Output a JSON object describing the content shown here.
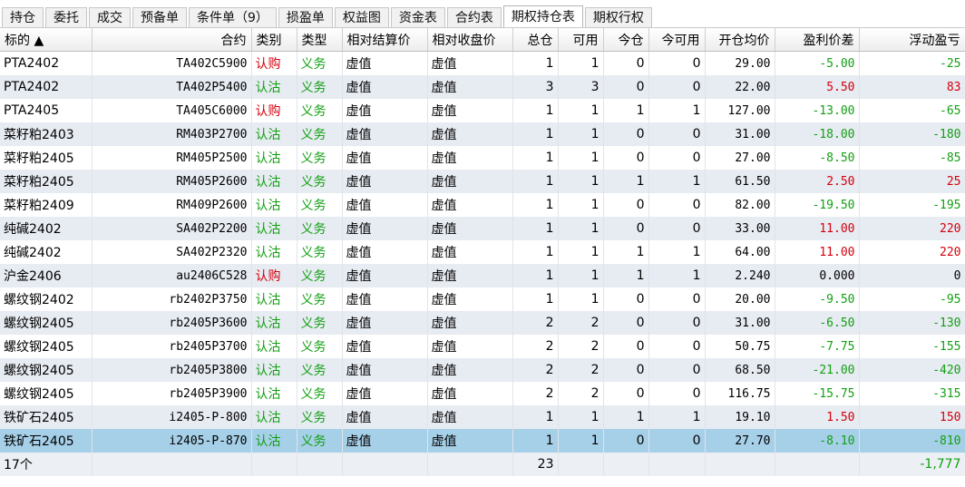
{
  "tabs": [
    "持仓",
    "委托",
    "成交",
    "预备单",
    "条件单（9）",
    "损盈单",
    "权益图",
    "资金表",
    "合约表",
    "期权持仓表",
    "期权行权"
  ],
  "active_tab": 9,
  "columns": [
    "标的 ▲",
    "合约",
    "类别",
    "类型",
    "相对结算价",
    "相对收盘价",
    "总仓",
    "可用",
    "今仓",
    "今可用",
    "开仓均价",
    "盈利价差",
    "浮动盈亏"
  ],
  "rows": [
    [
      "PTA2402",
      "TA402C5900",
      "认购",
      "义务",
      "虚值",
      "虚值",
      "1",
      "1",
      "0",
      "0",
      "29.00",
      "-5.00",
      "-25"
    ],
    [
      "PTA2402",
      "TA402P5400",
      "认沽",
      "义务",
      "虚值",
      "虚值",
      "3",
      "3",
      "0",
      "0",
      "22.00",
      "5.50",
      "83"
    ],
    [
      "PTA2405",
      "TA405C6000",
      "认购",
      "义务",
      "虚值",
      "虚值",
      "1",
      "1",
      "1",
      "1",
      "127.00",
      "-13.00",
      "-65"
    ],
    [
      "菜籽粕2403",
      "RM403P2700",
      "认沽",
      "义务",
      "虚值",
      "虚值",
      "1",
      "1",
      "0",
      "0",
      "31.00",
      "-18.00",
      "-180"
    ],
    [
      "菜籽粕2405",
      "RM405P2500",
      "认沽",
      "义务",
      "虚值",
      "虚值",
      "1",
      "1",
      "0",
      "0",
      "27.00",
      "-8.50",
      "-85"
    ],
    [
      "菜籽粕2405",
      "RM405P2600",
      "认沽",
      "义务",
      "虚值",
      "虚值",
      "1",
      "1",
      "1",
      "1",
      "61.50",
      "2.50",
      "25"
    ],
    [
      "菜籽粕2409",
      "RM409P2600",
      "认沽",
      "义务",
      "虚值",
      "虚值",
      "1",
      "1",
      "0",
      "0",
      "82.00",
      "-19.50",
      "-195"
    ],
    [
      "纯碱2402",
      "SA402P2200",
      "认沽",
      "义务",
      "虚值",
      "虚值",
      "1",
      "1",
      "0",
      "0",
      "33.00",
      "11.00",
      "220"
    ],
    [
      "纯碱2402",
      "SA402P2320",
      "认沽",
      "义务",
      "虚值",
      "虚值",
      "1",
      "1",
      "1",
      "1",
      "64.00",
      "11.00",
      "220"
    ],
    [
      "沪金2406",
      "au2406C528",
      "认购",
      "义务",
      "虚值",
      "虚值",
      "1",
      "1",
      "1",
      "1",
      "2.240",
      "0.000",
      "0"
    ],
    [
      "螺纹钢2402",
      "rb2402P3750",
      "认沽",
      "义务",
      "虚值",
      "虚值",
      "1",
      "1",
      "0",
      "0",
      "20.00",
      "-9.50",
      "-95"
    ],
    [
      "螺纹钢2405",
      "rb2405P3600",
      "认沽",
      "义务",
      "虚值",
      "虚值",
      "2",
      "2",
      "0",
      "0",
      "31.00",
      "-6.50",
      "-130"
    ],
    [
      "螺纹钢2405",
      "rb2405P3700",
      "认沽",
      "义务",
      "虚值",
      "虚值",
      "2",
      "2",
      "0",
      "0",
      "50.75",
      "-7.75",
      "-155"
    ],
    [
      "螺纹钢2405",
      "rb2405P3800",
      "认沽",
      "义务",
      "虚值",
      "虚值",
      "2",
      "2",
      "0",
      "0",
      "68.50",
      "-21.00",
      "-420"
    ],
    [
      "螺纹钢2405",
      "rb2405P3900",
      "认沽",
      "义务",
      "虚值",
      "虚值",
      "2",
      "2",
      "0",
      "0",
      "116.75",
      "-15.75",
      "-315"
    ],
    [
      "铁矿石2405",
      "i2405-P-800",
      "认沽",
      "义务",
      "虚值",
      "虚值",
      "1",
      "1",
      "1",
      "1",
      "19.10",
      "1.50",
      "150"
    ],
    [
      "铁矿石2405",
      "i2405-P-870",
      "认沽",
      "义务",
      "虚值",
      "虚值",
      "1",
      "1",
      "0",
      "0",
      "27.70",
      "-8.10",
      "-810"
    ]
  ],
  "selected_row": 16,
  "footer": {
    "count": "17个",
    "total": "23",
    "pnl": "-1,777"
  },
  "colors": {
    "red": "#d4000c",
    "green": "#12a012",
    "selected": "#a6cfe8",
    "stripe": "#e7ebf2"
  }
}
